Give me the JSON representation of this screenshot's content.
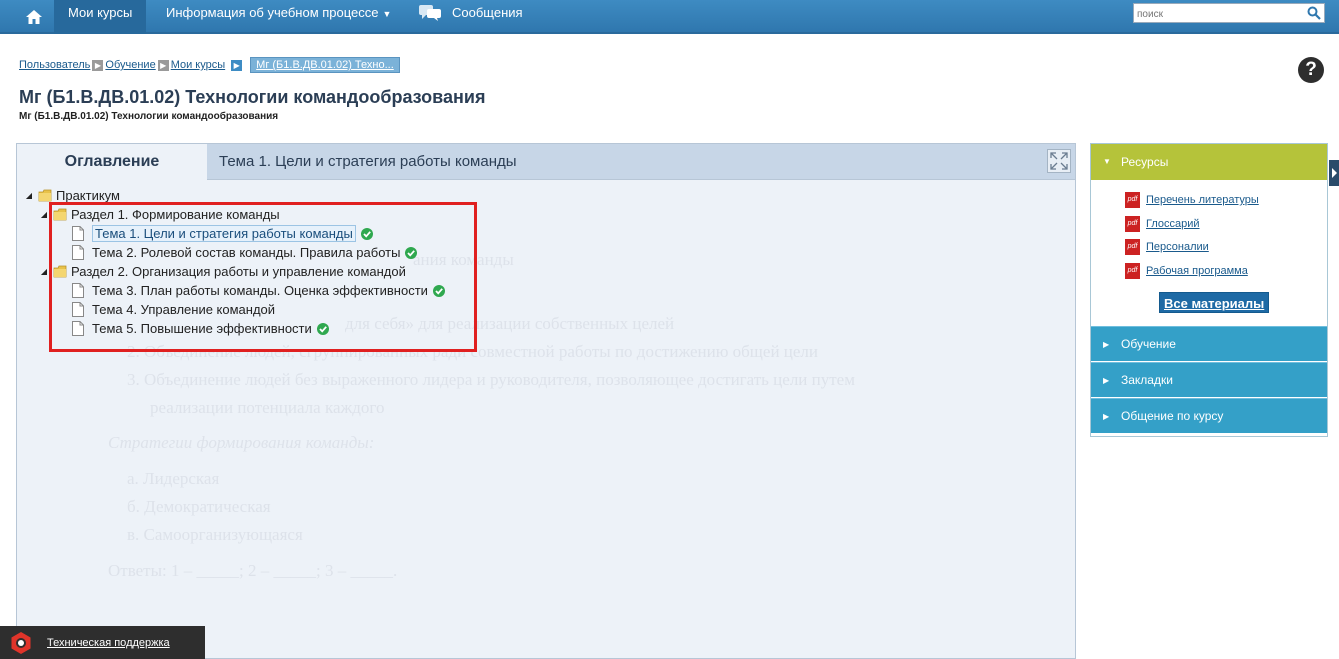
{
  "nav": {
    "home_icon": "home-icon",
    "items": [
      {
        "label": "Мои курсы",
        "active": true
      },
      {
        "label": "Информация об учебном процессе",
        "has_dropdown": true
      },
      {
        "label": "Сообщения"
      }
    ],
    "search_placeholder": "поиск"
  },
  "breadcrumb": {
    "items": [
      "Пользователь",
      "Обучение",
      "Мои курсы"
    ],
    "current": "Мг (Б1.В.ДВ.01.02) Техно..."
  },
  "page": {
    "title": "Мг (Б1.В.ДВ.01.02) Технологии командообразования",
    "subtitle": "Мг (Б1.В.ДВ.01.02) Технологии командообразования",
    "help": "?"
  },
  "panel": {
    "tab_label": "Оглавление",
    "topic_title": "Тема 1. Цели и стратегия работы команды"
  },
  "tree": {
    "root": "Практикум",
    "sections": [
      {
        "label": "Раздел 1. Формирование команды",
        "topics": [
          {
            "label": "Тема 1. Цели и стратегия работы команды",
            "done": true,
            "selected": true
          },
          {
            "label": "Тема 2. Ролевой состав команды. Правила работы",
            "done": true
          }
        ]
      },
      {
        "label": "Раздел 2. Организация работы и управление командой",
        "topics": [
          {
            "label": "Тема 3. План работы команды. Оценка эффективности",
            "done": true
          },
          {
            "label": "Тема 4. Управление командой",
            "done": false
          },
          {
            "label": "Тема 5. Повышение эффективности",
            "done": true
          }
        ]
      }
    ]
  },
  "content_ghost": {
    "line1": "ания команды",
    "line2": "для себя» для реализации собственных целей",
    "line3": "2.  Объединение людей, сгруппированных ради совместной работы по достижению общей цели",
    "line4": "3.  Объединение людей без выраженного лидера и руководителя, позволяющее достигать цели путем",
    "line5": "реализации потенциала каждого",
    "line6": "Стратегии формирования команды:",
    "line7": "а.  Лидерская",
    "line8": "б.  Демократическая",
    "line9": "в.  Самоорганизующаяся",
    "line10": "Ответы: 1 – _____; 2 – _____; 3 – _____."
  },
  "sidebar": {
    "resources_label": "Ресурсы",
    "resources": [
      "Перечень литературы",
      "Глоссарий",
      "Персоналии",
      "Рабочая программа"
    ],
    "pdf_label": "pdf",
    "all_materials": "Все материалы",
    "sections": [
      "Обучение",
      "Закладки",
      "Общение по курсу"
    ]
  },
  "support": {
    "label": "Техническая поддержка"
  },
  "colors": {
    "nav": "#3e8bc2",
    "resources_head": "#b5c33a",
    "sidebar_section": "#34a0c8",
    "highlight": "#e02020"
  }
}
